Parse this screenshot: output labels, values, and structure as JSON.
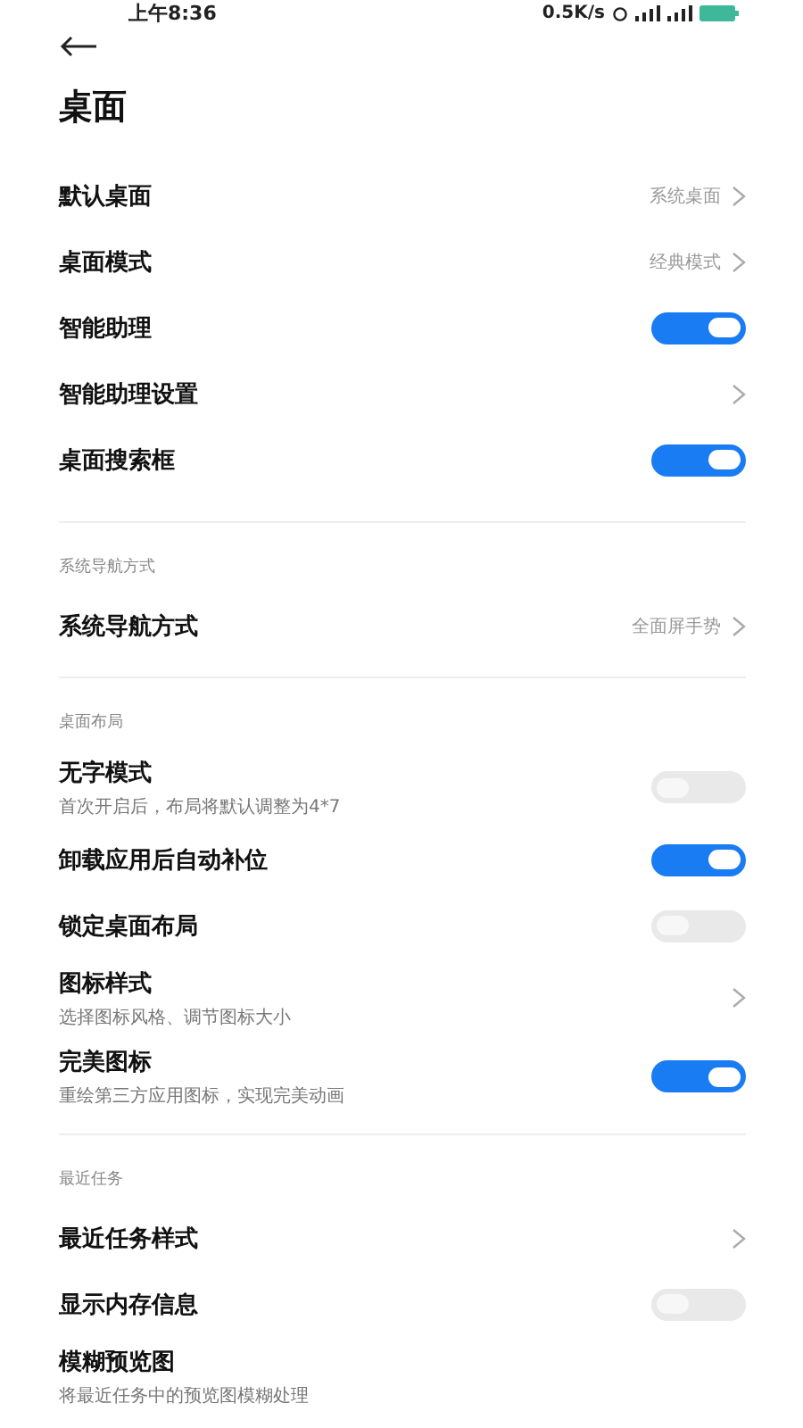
{
  "status_bar": {
    "time": "上午8:36",
    "speed": "0.5K/s"
  },
  "title": "桌面",
  "sections": [
    {
      "rows": [
        {
          "kind": "link",
          "label": "默认桌面",
          "value": "系统桌面"
        },
        {
          "kind": "link",
          "label": "桌面模式",
          "value": "经典模式"
        },
        {
          "kind": "toggle",
          "label": "智能助理",
          "on": true
        },
        {
          "kind": "link",
          "label": "智能助理设置"
        },
        {
          "kind": "toggle",
          "label": "桌面搜索框",
          "on": true
        }
      ]
    },
    {
      "header": "系统导航方式",
      "rows": [
        {
          "kind": "link",
          "label": "系统导航方式",
          "value": "全面屏手势"
        }
      ]
    },
    {
      "header": "桌面布局",
      "rows": [
        {
          "kind": "toggle",
          "label": "无字模式",
          "subtitle": "首次开启后，布局将默认调整为4*7",
          "on": false
        },
        {
          "kind": "toggle",
          "label": "卸载应用后自动补位",
          "on": true
        },
        {
          "kind": "toggle",
          "label": "锁定桌面布局",
          "on": false
        },
        {
          "kind": "link",
          "label": "图标样式",
          "subtitle": "选择图标风格、调节图标大小"
        },
        {
          "kind": "toggle",
          "label": "完美图标",
          "subtitle": "重绘第三方应用图标，实现完美动画",
          "on": true
        }
      ]
    },
    {
      "header": "最近任务",
      "rows": [
        {
          "kind": "link",
          "label": "最近任务样式"
        },
        {
          "kind": "toggle",
          "label": "显示内存信息",
          "on": false
        },
        {
          "kind": "plain",
          "label": "模糊预览图",
          "subtitle": "将最近任务中的预览图模糊处理"
        }
      ]
    }
  ]
}
